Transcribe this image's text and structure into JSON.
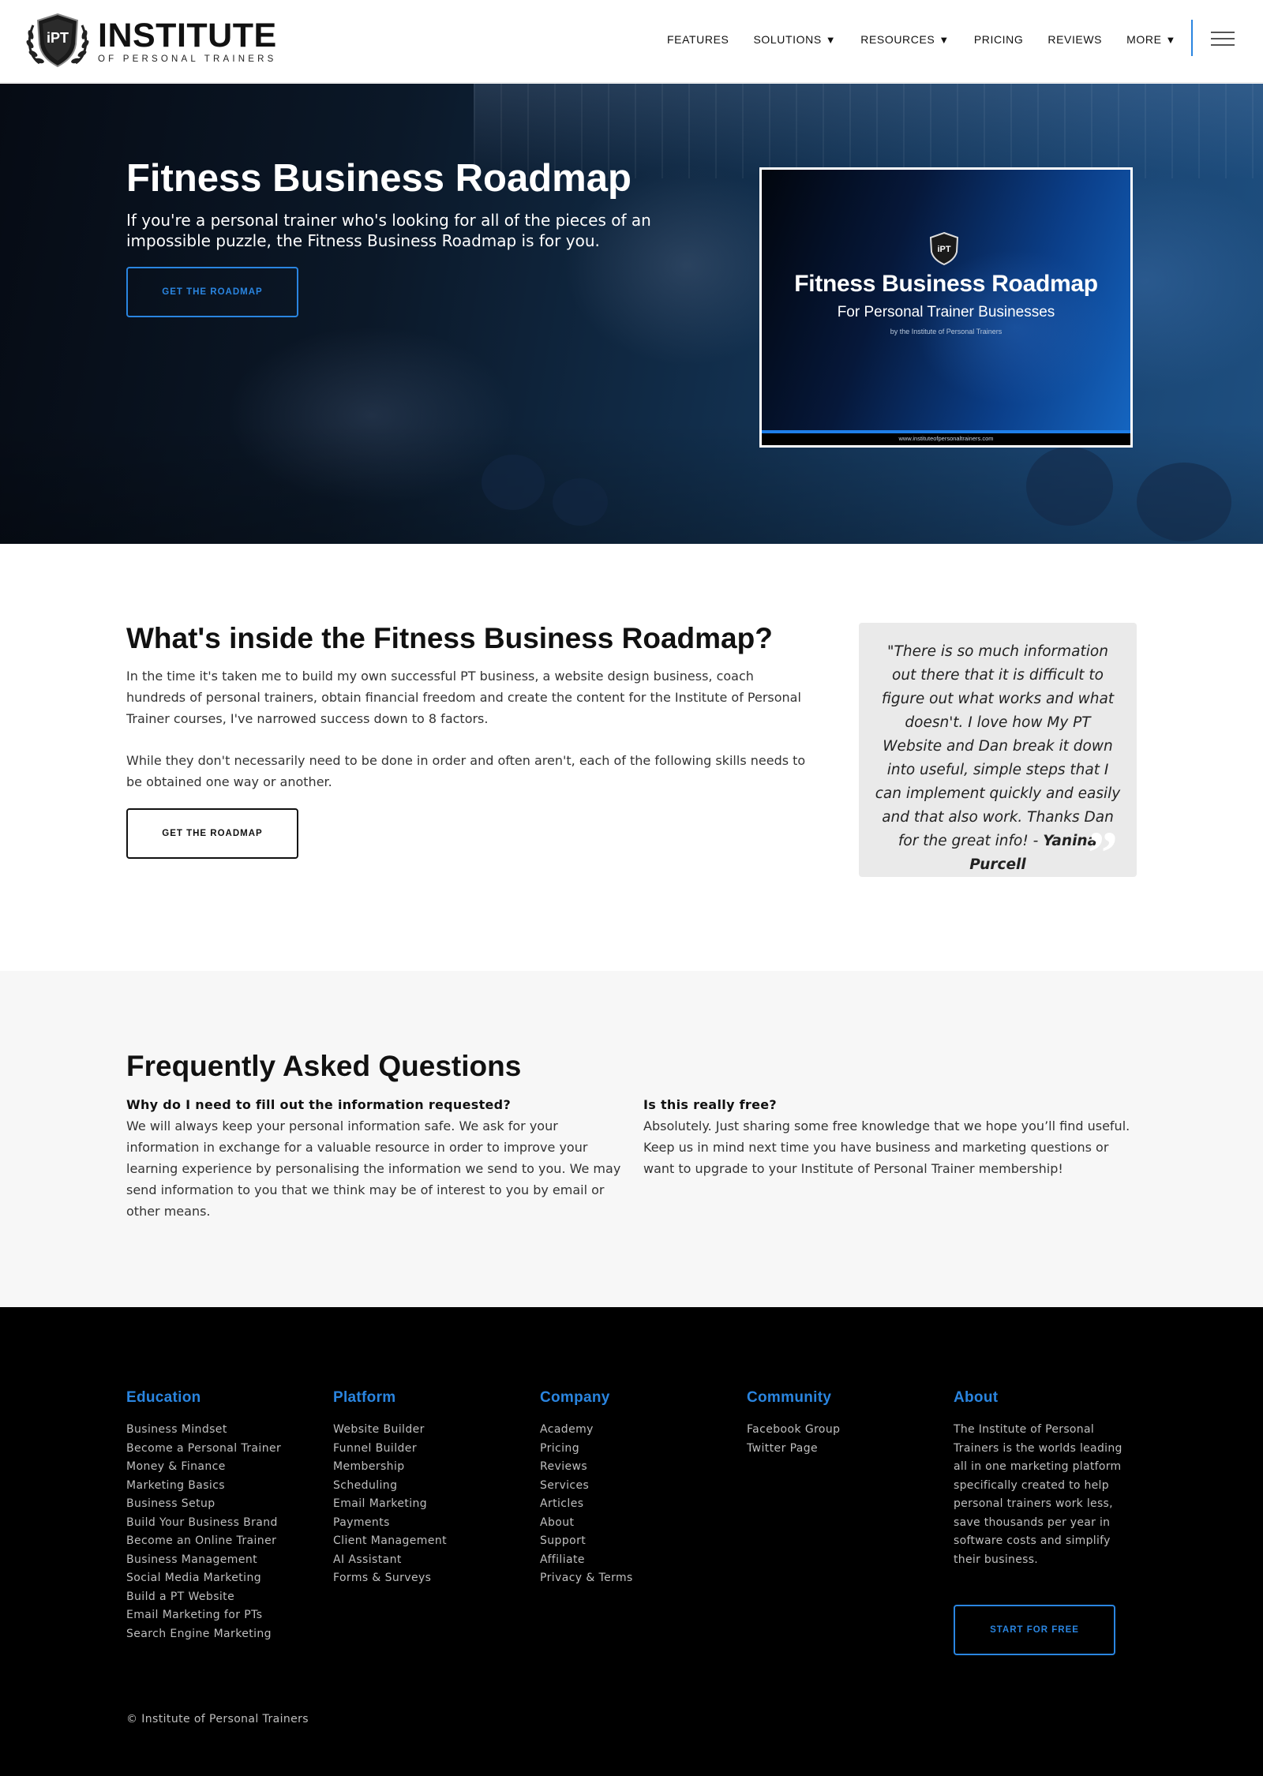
{
  "header": {
    "logo_title": "INSTITUTE",
    "logo_subtitle": "OF PERSONAL TRAINERS",
    "logo_badge_text": "iPT",
    "nav": {
      "features": "FEATURES",
      "solutions": "SOLUTIONS",
      "resources": "RESOURCES",
      "pricing": "PRICING",
      "reviews": "REVIEWS",
      "more": "MORE",
      "caret": "▼"
    },
    "accent_color": "#2a85e0"
  },
  "hero": {
    "title": "Fitness Business Roadmap",
    "description": "If you're a personal trainer who's looking for all of the pieces of an impossible puzzle, the Fitness Business Roadmap is for you.",
    "cta_label": "GET THE ROADMAP",
    "cover": {
      "badge_text": "iPT",
      "title": "Fitness Business Roadmap",
      "subtitle": "For Personal Trainer Businesses",
      "byline": "by the Institute of Personal Trainers",
      "url": "www.instituteofpersonaltrainers.com"
    }
  },
  "inside": {
    "title": "What's inside the Fitness Business Roadmap?",
    "paragraph_1": "In the time it's taken me to build my own successful PT business, a website design business, coach hundreds of personal trainers, obtain financial freedom and create the content for the Institute of Personal Trainer courses, I've narrowed success down to 8 factors.",
    "paragraph_2": "While they don't necessarily need to be done in order and often aren't, each of the following skills needs to be obtained one way or another.",
    "cta_label": "GET THE ROADMAP",
    "testimonial": {
      "text": "\"There is so much information out there that it is difficult to figure out what works and what doesn't. I love how My PT Website and Dan break it down into useful, simple steps that I can implement quickly and easily and that also work. Thanks Dan for the great info! - ",
      "author": "Yanina Purcell",
      "quote_mark": "”"
    }
  },
  "faq": {
    "title": "Frequently Asked Questions",
    "items": [
      {
        "question": "Why do I need to fill out the information requested?",
        "answer": "We will always keep your personal information safe. We ask for your information in exchange for a valuable resource in order to improve your learning experience by personalising the information we send to you. We may send information to you that we think may be of interest to you by email or other means."
      },
      {
        "question": "Is this really free?",
        "answer": "Absolutely. Just sharing some free knowledge that we hope you’ll find useful. Keep us in mind next time you have business and marketing questions or want to upgrade to your Institute of Personal Trainer membership!"
      }
    ]
  },
  "footer": {
    "education": {
      "heading": "Education",
      "links": [
        "Business Mindset",
        "Become a Personal Trainer",
        "Money & Finance",
        "Marketing Basics",
        "Business Setup",
        "Build Your Business Brand",
        "Become an Online Trainer",
        "Business Management",
        "Social Media Marketing",
        "Build a PT Website",
        "Email Marketing for PTs",
        "Search Engine Marketing"
      ]
    },
    "platform": {
      "heading": "Platform",
      "links": [
        "Website Builder",
        "Funnel Builder",
        "Membership",
        "Scheduling",
        "Email Marketing",
        "Payments",
        "Client Management",
        "AI Assistant",
        "Forms & Surveys"
      ]
    },
    "company": {
      "heading": "Company",
      "links": [
        "Academy",
        "Pricing",
        "Reviews",
        "Services",
        "Articles",
        "About",
        "Support",
        "Affiliate",
        "Privacy & Terms"
      ]
    },
    "community": {
      "heading": "Community",
      "links": [
        "Facebook Group",
        "Twitter Page"
      ]
    },
    "about": {
      "heading": "About",
      "text": "The Institute of Personal Trainers is the worlds leading all in one marketing platform specifically created to help personal trainers work less, save thousands per year in software costs and simplify their business.",
      "cta_label": "START FOR FREE"
    },
    "copyright": "© Institute of Personal Trainers"
  }
}
